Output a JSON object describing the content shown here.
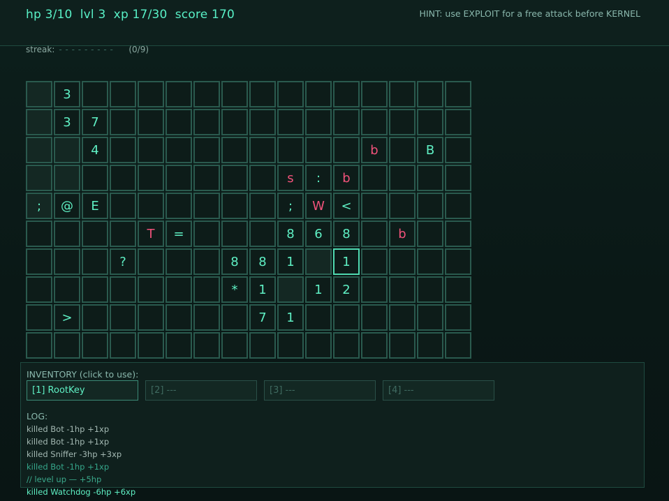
{
  "status": {
    "stats": "hp 3/10  lvl 3  xp 17/30  score 170",
    "hint": "HINT: use EXPLOIT for a free attack before KERNEL"
  },
  "streak": {
    "label": "streak:",
    "dashes": "- - - - - - - - -",
    "count": "(0/9)"
  },
  "grid": {
    "cols": 16,
    "rows": 10,
    "cells": [
      [
        "",
        "3",
        "",
        "",
        "",
        "",
        "",
        "",
        "",
        "",
        "",
        "",
        "",
        "",
        "",
        ""
      ],
      [
        "",
        "3",
        "7",
        "",
        "",
        "",
        "",
        "",
        "",
        "",
        "",
        "",
        "",
        "",
        "",
        ""
      ],
      [
        "",
        "",
        "4",
        "",
        "",
        "",
        "",
        "",
        "",
        "",
        "",
        "",
        "b",
        "",
        "B",
        ""
      ],
      [
        "",
        "",
        "",
        "",
        "",
        "",
        "",
        "",
        "",
        "s",
        ":",
        "b",
        "",
        "",
        "",
        ""
      ],
      [
        ";",
        "@",
        "E",
        "",
        "",
        "",
        "",
        "",
        "",
        ";",
        "W",
        "<",
        "",
        "",
        "",
        ""
      ],
      [
        "",
        "",
        "",
        "",
        "T",
        "=",
        "",
        "",
        "",
        "8",
        "6",
        "8",
        "",
        "b",
        "",
        ""
      ],
      [
        "",
        "",
        "",
        "?",
        "",
        "",
        "",
        "8",
        "8",
        "1",
        "",
        "1",
        "",
        "",
        "",
        ""
      ],
      [
        "",
        "",
        "",
        "",
        "",
        "",
        "",
        "*",
        "1",
        "",
        "1",
        "2",
        "",
        "",
        "",
        ""
      ],
      [
        "",
        ">",
        "",
        "",
        "",
        "",
        "",
        "",
        "7",
        "1",
        "",
        "",
        "",
        "",
        "",
        ""
      ],
      [
        "",
        "",
        "",
        "",
        "",
        "",
        "",
        "",
        "",
        "",
        "",
        "",
        "",
        "",
        "",
        ""
      ]
    ],
    "enemy_cells": [
      [
        2,
        12
      ],
      [
        3,
        9
      ],
      [
        3,
        11
      ],
      [
        4,
        10
      ],
      [
        5,
        4
      ],
      [
        5,
        13
      ]
    ],
    "dim_cells": [
      [
        0,
        0
      ],
      [
        1,
        0
      ],
      [
        2,
        0
      ],
      [
        2,
        1
      ],
      [
        3,
        0
      ],
      [
        3,
        1
      ],
      [
        4,
        0
      ],
      [
        6,
        10
      ],
      [
        7,
        9
      ]
    ],
    "selected_cell": [
      6,
      11
    ],
    "colors": {
      "text": "#5ff0c4",
      "enemy": "#f0527a",
      "border": "#2a5a4e",
      "background": "#0a1a18"
    }
  },
  "inventory": {
    "title": "INVENTORY (click to use):",
    "slots": [
      {
        "label": "[1] RootKey",
        "filled": true
      },
      {
        "label": "[2] ---",
        "filled": false
      },
      {
        "label": "[3] ---",
        "filled": false
      },
      {
        "label": "[4] ---",
        "filled": false
      }
    ]
  },
  "log": {
    "title": "LOG:",
    "lines": [
      {
        "text": "killed Bot  -1hp  +1xp",
        "style": "normal"
      },
      {
        "text": "killed Bot  -1hp  +1xp",
        "style": "normal"
      },
      {
        "text": "killed Sniffer  -3hp  +3xp",
        "style": "normal"
      },
      {
        "text": "killed Bot  -1hp  +1xp",
        "style": "fade"
      },
      {
        "text": "// level up — +5hp",
        "style": "levelup"
      },
      {
        "text": "killed Watchdog  -6hp  +6xp",
        "style": "latest"
      }
    ]
  }
}
